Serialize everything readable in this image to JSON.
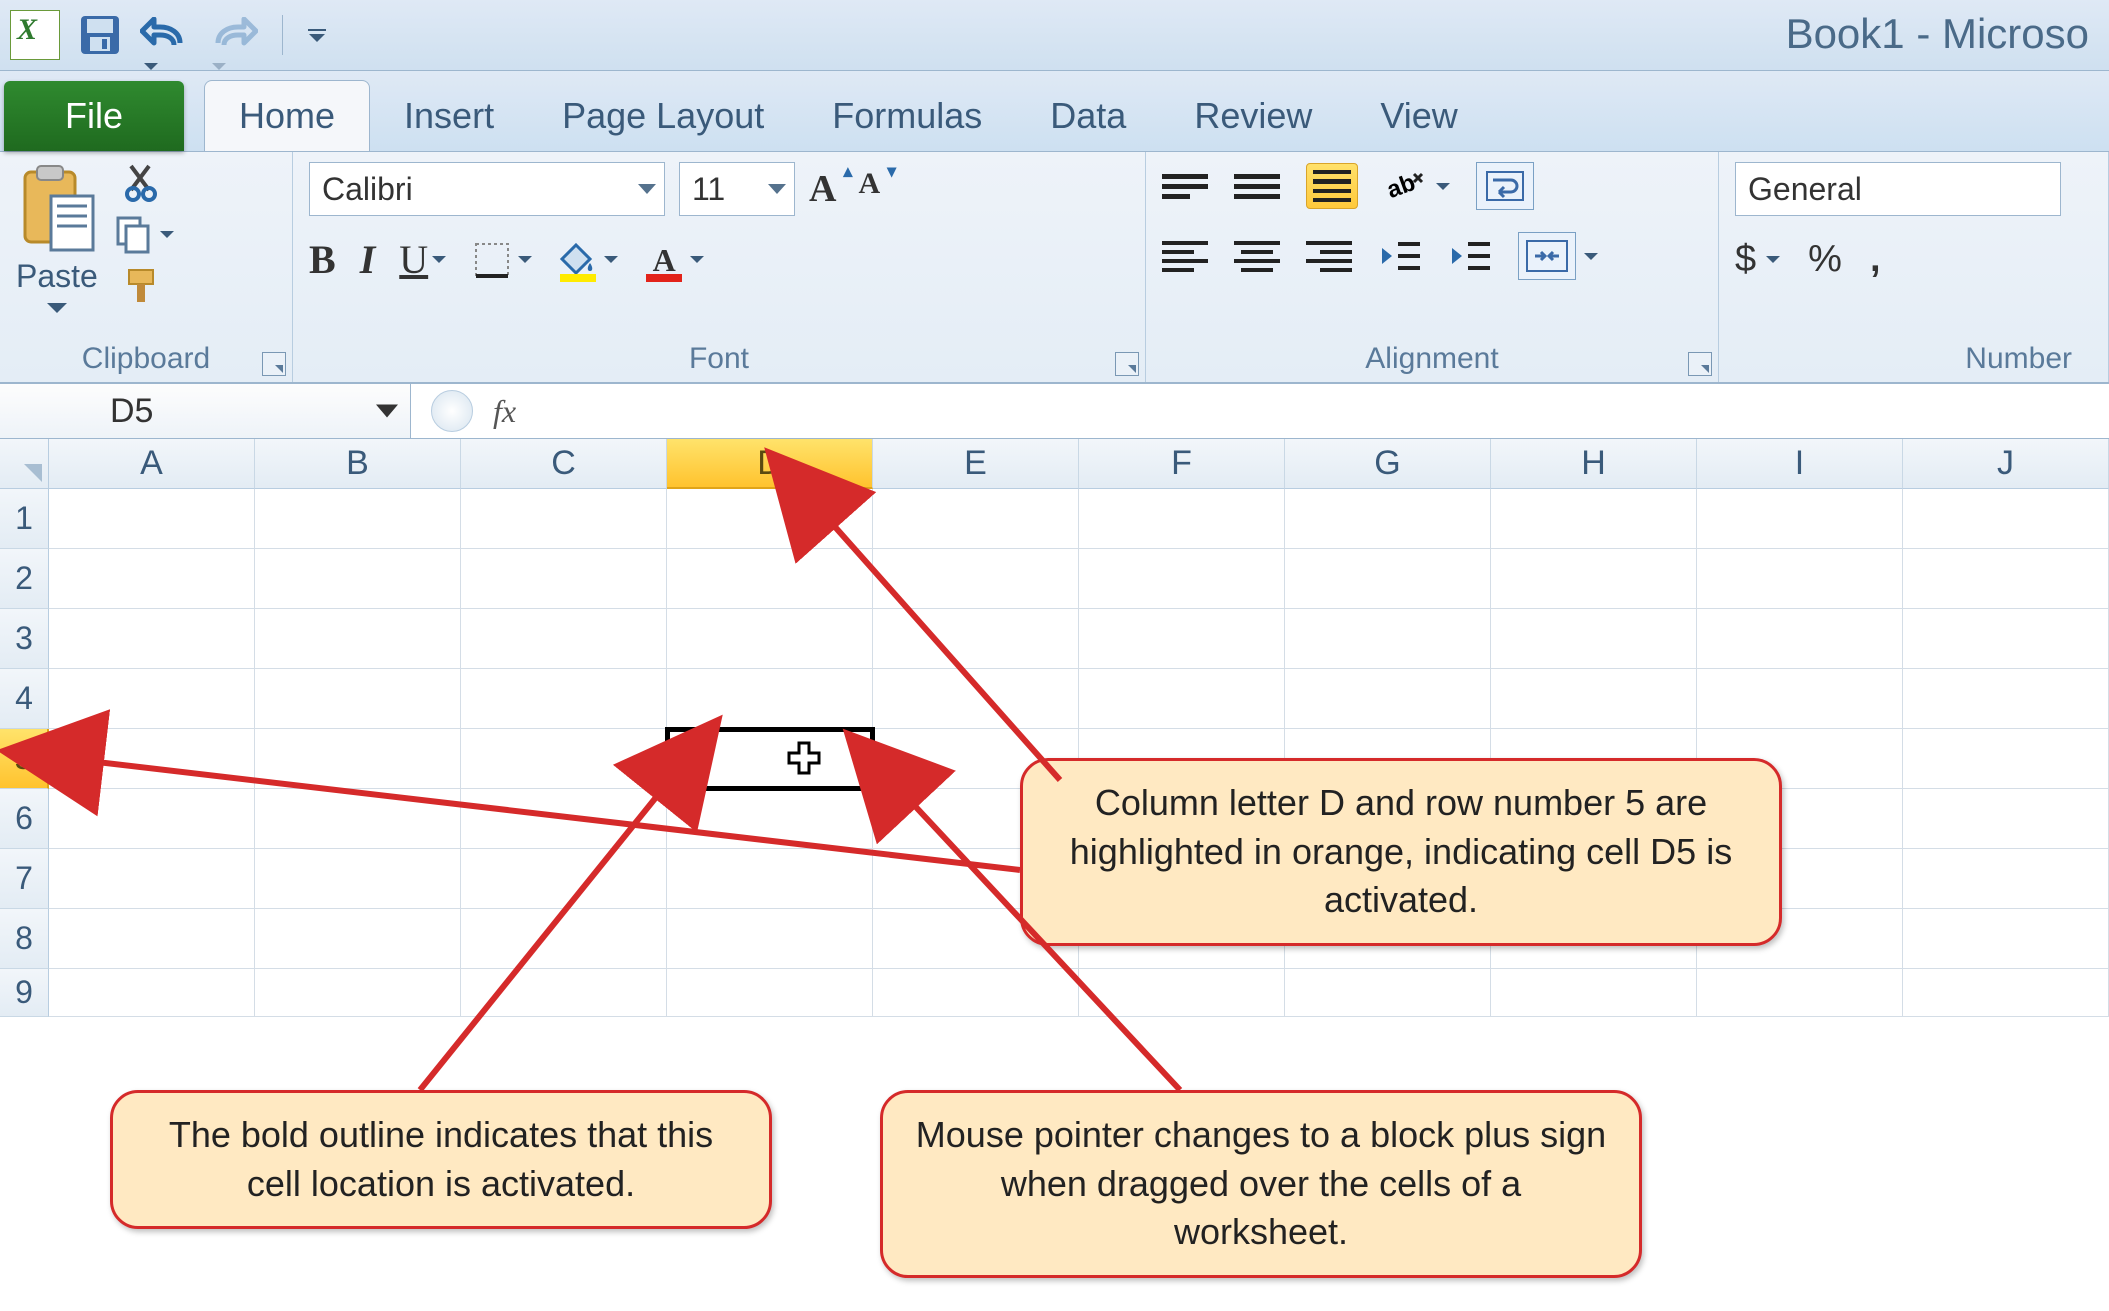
{
  "title": "Book1 - Microso",
  "qat": {
    "undo": "undo",
    "redo": "redo",
    "save": "save"
  },
  "tabs": {
    "file": "File",
    "items": [
      "Home",
      "Insert",
      "Page Layout",
      "Formulas",
      "Data",
      "Review",
      "View"
    ],
    "active": "Home"
  },
  "ribbon": {
    "clipboard": {
      "label": "Clipboard",
      "paste": "Paste"
    },
    "font": {
      "label": "Font",
      "name": "Calibri",
      "size": "11",
      "bold": "B",
      "italic": "I",
      "underline": "U",
      "grow": "A",
      "shrink": "A",
      "fontcolor_letter": "A"
    },
    "alignment": {
      "label": "Alignment"
    },
    "number": {
      "label": "Number",
      "format": "General",
      "currency": "$",
      "percent": "%",
      "comma": ","
    }
  },
  "formula_bar": {
    "name_box": "D5",
    "fx": "fx"
  },
  "grid": {
    "columns": [
      "A",
      "B",
      "C",
      "D",
      "E",
      "F",
      "G",
      "H",
      "I",
      "J"
    ],
    "rows": [
      "1",
      "2",
      "3",
      "4",
      "5",
      "6",
      "7",
      "8",
      "9"
    ],
    "active_col": "D",
    "active_row": "5"
  },
  "callouts": {
    "c1": "Column letter D and row number 5 are highlighted in orange, indicating cell D5 is activated.",
    "c2": "The bold outline indicates that this cell location is activated.",
    "c3": "Mouse pointer changes to a block plus sign when dragged over the cells of a worksheet."
  }
}
